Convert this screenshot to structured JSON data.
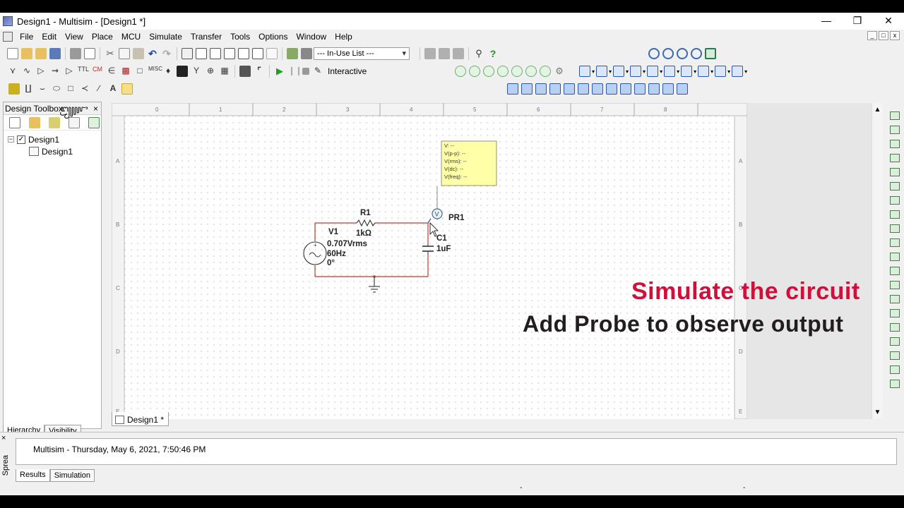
{
  "window": {
    "title": "Design1 - Multisim - [Design1 *]",
    "controls": {
      "minimize": "—",
      "restore": "❐",
      "close": "✕"
    }
  },
  "menu": [
    "File",
    "Edit",
    "View",
    "Place",
    "MCU",
    "Simulate",
    "Transfer",
    "Tools",
    "Options",
    "Window",
    "Help"
  ],
  "toolbar": {
    "in_use_list": "--- In-Use List ---",
    "run_mode": "Interactive"
  },
  "design_toolbox": {
    "title": "Design Toolbox",
    "pin": "᭾",
    "close": "×",
    "tree": {
      "root": "Design1",
      "child": "Design1",
      "expander": "−",
      "check": "✓"
    },
    "tabs": [
      "Hierarchy",
      "Visibility"
    ]
  },
  "sheet": {
    "ruler_top": [
      "0",
      "1",
      "2",
      "3",
      "4",
      "5",
      "6",
      "7",
      "8"
    ],
    "ruler_side": [
      "A",
      "B",
      "C",
      "D",
      "E"
    ]
  },
  "schematic": {
    "source": {
      "ref": "V1",
      "voltage": "0.707Vrms",
      "freq": "60Hz",
      "phase": "0°"
    },
    "resistor": {
      "ref": "R1",
      "value": "1kΩ"
    },
    "capacitor": {
      "ref": "C1",
      "value": "1uF"
    },
    "probe": {
      "ref": "PR1",
      "symbol": "V"
    },
    "probe_readout": [
      "V: --",
      "V(p-p): --",
      "V(rms): --",
      "V(dc): --",
      "V(freq): --"
    ]
  },
  "document_tab": {
    "label": "Design1 *"
  },
  "overlay": {
    "line1": "Simulate the circuit",
    "line2": "Add Probe to observe output"
  },
  "spreadsheet": {
    "side_label": "Sprea",
    "close": "×",
    "message": "Multisim  -  Thursday, May 6, 2021, 7:50:46 PM",
    "tabs": [
      "Results",
      "Simulation"
    ]
  },
  "scroll": {
    "up": "▲",
    "down": "▼"
  },
  "status": {
    "mid1": "-",
    "mid2": "-"
  },
  "colors": {
    "accent_red": "#d0103a",
    "wire_red": "#c0392b",
    "probe_box": "#ffffa8",
    "ruler_bg": "#f3f3f3"
  }
}
